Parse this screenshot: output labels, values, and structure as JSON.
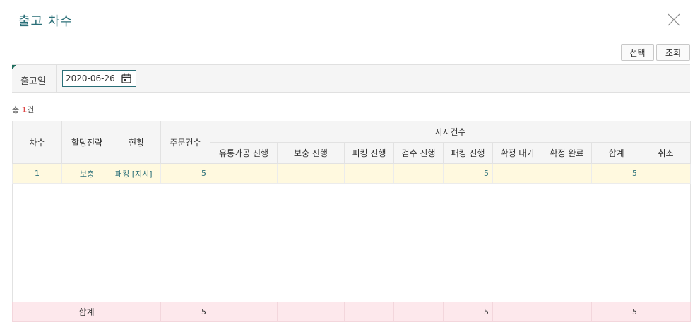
{
  "title": "출고 차수",
  "buttons": {
    "select": "선택",
    "search": "조회"
  },
  "filter": {
    "label": "출고일",
    "date": "2020-06-26"
  },
  "count": {
    "prefix": "총 ",
    "value": "1",
    "suffix": "건"
  },
  "table": {
    "headers": {
      "round": "차수",
      "strategy": "할당전략",
      "status": "현황",
      "orders": "주문건수",
      "group": "지시건수",
      "sub": [
        "유통가공 진행",
        "보충 진행",
        "피킹 진행",
        "검수 진행",
        "패킹 진행",
        "확정 대기",
        "확정 완료",
        "합계",
        "취소"
      ]
    },
    "rows": [
      {
        "round": "1",
        "strategy": "보충",
        "status": "패킹 [지시]",
        "orders": "5",
        "values": [
          "",
          "",
          "",
          "",
          "5",
          "",
          "",
          "5",
          ""
        ]
      }
    ],
    "total": {
      "label": "합계",
      "orders": "5",
      "values": [
        "",
        "",
        "",
        "",
        "5",
        "",
        "",
        "5",
        ""
      ]
    }
  },
  "colors": {
    "accent": "#2a6f78",
    "row_highlight": "#fff9df",
    "total_row": "#fde8ec",
    "count_number": "#e04848"
  },
  "icons": {
    "close": "close-icon",
    "calendar": "calendar-icon"
  }
}
